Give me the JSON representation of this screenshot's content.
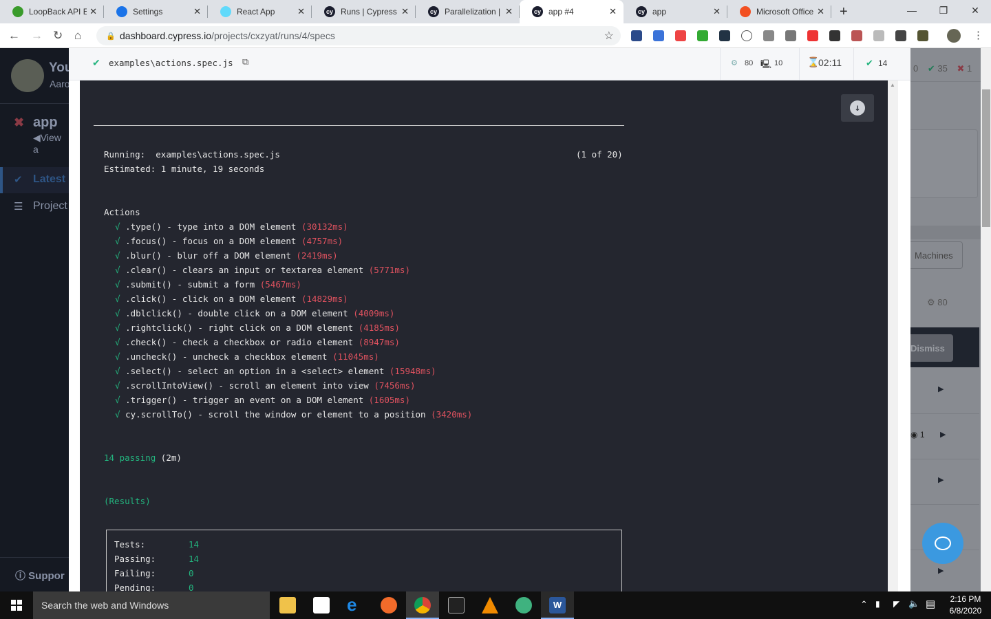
{
  "browser": {
    "tabs": [
      {
        "label": "LoopBack API Ex",
        "icon": "loopback-icon",
        "color": "#3a9b2b"
      },
      {
        "label": "Settings",
        "icon": "gear-icon",
        "color": "#1a73e8"
      },
      {
        "label": "React App",
        "icon": "react-icon",
        "color": "#61dafb"
      },
      {
        "label": "Runs | Cypress D",
        "icon": "cypress-icon",
        "color": "#1b1e2e"
      },
      {
        "label": "Parallelization | C",
        "icon": "cypress-icon",
        "color": "#1b1e2e"
      },
      {
        "label": "app #4",
        "icon": "cypress-icon",
        "color": "#1b1e2e",
        "active": true
      },
      {
        "label": "app",
        "icon": "cypress-icon",
        "color": "#1b1e2e"
      },
      {
        "label": "Microsoft Office",
        "icon": "microsoft-icon",
        "color": "#f25022"
      }
    ],
    "url_host": "dashboard.cypress.io",
    "url_path": "/projects/cxzyat/runs/4/specs"
  },
  "sidebar": {
    "user_name": "You",
    "user_sub": "Aaro",
    "project": "app",
    "view_link": "View a",
    "items": [
      {
        "label": "Latest"
      },
      {
        "label": "Project"
      }
    ],
    "support": "Suppor"
  },
  "spec": {
    "filename": "examples\\actions.spec.js",
    "cpu": "80",
    "machines": "10",
    "duration": "02:11",
    "passed": "14"
  },
  "terminal": {
    "running_label": "Running:",
    "running_file": "examples\\actions.spec.js",
    "running_count": "(1 of 20)",
    "estimated": "Estimated: 1 minute, 19 seconds",
    "suite": "Actions",
    "check": "√",
    "tests": [
      {
        "title": ".type() - type into a DOM element",
        "duration": "(30132ms)"
      },
      {
        "title": ".focus() - focus on a DOM element",
        "duration": "(4757ms)"
      },
      {
        "title": ".blur() - blur off a DOM element",
        "duration": "(2419ms)"
      },
      {
        "title": ".clear() - clears an input or textarea element",
        "duration": "(5771ms)"
      },
      {
        "title": ".submit() - submit a form",
        "duration": "(5467ms)"
      },
      {
        "title": ".click() - click on a DOM element",
        "duration": "(14829ms)"
      },
      {
        "title": ".dblclick() - double click on a DOM element",
        "duration": "(4009ms)"
      },
      {
        "title": ".rightclick() - right click on a DOM element",
        "duration": "(4185ms)"
      },
      {
        "title": ".check() - check a checkbox or radio element",
        "duration": "(8947ms)"
      },
      {
        "title": ".uncheck() - uncheck a checkbox element",
        "duration": "(11045ms)"
      },
      {
        "title": ".select() - select an option in a <select> element",
        "duration": "(15948ms)"
      },
      {
        "title": ".scrollIntoView() - scroll an element into view",
        "duration": "(7456ms)"
      },
      {
        "title": ".trigger() - trigger an event on a DOM element",
        "duration": "(1605ms)"
      },
      {
        "title": "cy.scrollTo() - scroll the window or element to a position",
        "duration": "(3420ms)"
      }
    ],
    "passing": "14 passing",
    "passing_time": "(2m)",
    "results": "(Results)",
    "summary": [
      {
        "label": "Tests:",
        "value": "14"
      },
      {
        "label": "Passing:",
        "value": "14"
      },
      {
        "label": "Failing:",
        "value": "0"
      },
      {
        "label": "Pending:",
        "value": "0"
      }
    ]
  },
  "background": {
    "pending": "0",
    "passed": "35",
    "failed": "1",
    "machines_btn": "Machines",
    "cpu": "80",
    "dismiss": "Dismiss",
    "screenshot_count": "1"
  },
  "taskbar": {
    "search": "Search the web and Windows",
    "time": "2:16 PM",
    "date": "6/8/2020"
  }
}
